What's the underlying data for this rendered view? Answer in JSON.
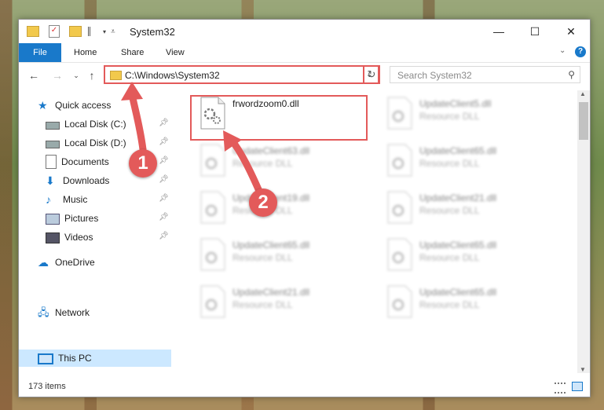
{
  "window": {
    "title": "System32",
    "controls": {
      "minimize": "—",
      "maximize": "☐",
      "close": "✕"
    }
  },
  "ribbon": {
    "tabs": [
      {
        "label": "File"
      },
      {
        "label": "Home"
      },
      {
        "label": "Share"
      },
      {
        "label": "View"
      }
    ]
  },
  "address_bar": {
    "path": "C:\\Windows\\System32"
  },
  "search": {
    "placeholder": "Search System32"
  },
  "sidebar": {
    "items": [
      {
        "label": "Quick access",
        "icon": "star-icon"
      },
      {
        "label": "Local Disk (C:)",
        "icon": "drive-icon",
        "pinned": true
      },
      {
        "label": "Local Disk (D:)",
        "icon": "drive-icon",
        "pinned": true
      },
      {
        "label": "Documents",
        "icon": "documents-icon",
        "pinned": true
      },
      {
        "label": "Downloads",
        "icon": "downloads-icon",
        "pinned": true
      },
      {
        "label": "Music",
        "icon": "music-icon",
        "pinned": true
      },
      {
        "label": "Pictures",
        "icon": "pictures-icon",
        "pinned": true
      },
      {
        "label": "Videos",
        "icon": "videos-icon",
        "pinned": true
      },
      {
        "label": "OneDrive",
        "icon": "cloud-icon"
      },
      {
        "label": "This PC",
        "icon": "computer-icon",
        "selected": true
      },
      {
        "label": "Network",
        "icon": "network-icon"
      }
    ]
  },
  "files": [
    {
      "name": "frwordzoom0.dll",
      "type": ""
    },
    {
      "name": "UpdateClient5.dll",
      "type": "Resource DLL"
    },
    {
      "name": "UpdateClient63.dll",
      "type": "Resource DLL"
    },
    {
      "name": "UpdateClient65.dll",
      "type": "Resource DLL"
    },
    {
      "name": "UpdateClient19.dll",
      "type": "Resource DLL"
    },
    {
      "name": "UpdateClient21.dll",
      "type": "Resource DLL"
    },
    {
      "name": "UpdateClient65.dll",
      "type": "Resource DLL"
    },
    {
      "name": "UpdateClient65.dll",
      "type": "Resource DLL"
    },
    {
      "name": "UpdateClient21.dll",
      "type": "Resource DLL"
    },
    {
      "name": "UpdateClient65.dll",
      "type": "Resource DLL"
    }
  ],
  "status": {
    "items_count": "173 items"
  },
  "callouts": [
    "1",
    "2"
  ],
  "colors": {
    "accent": "#1979ca",
    "annotation": "#e35a5a",
    "selection": "#cce8ff"
  }
}
